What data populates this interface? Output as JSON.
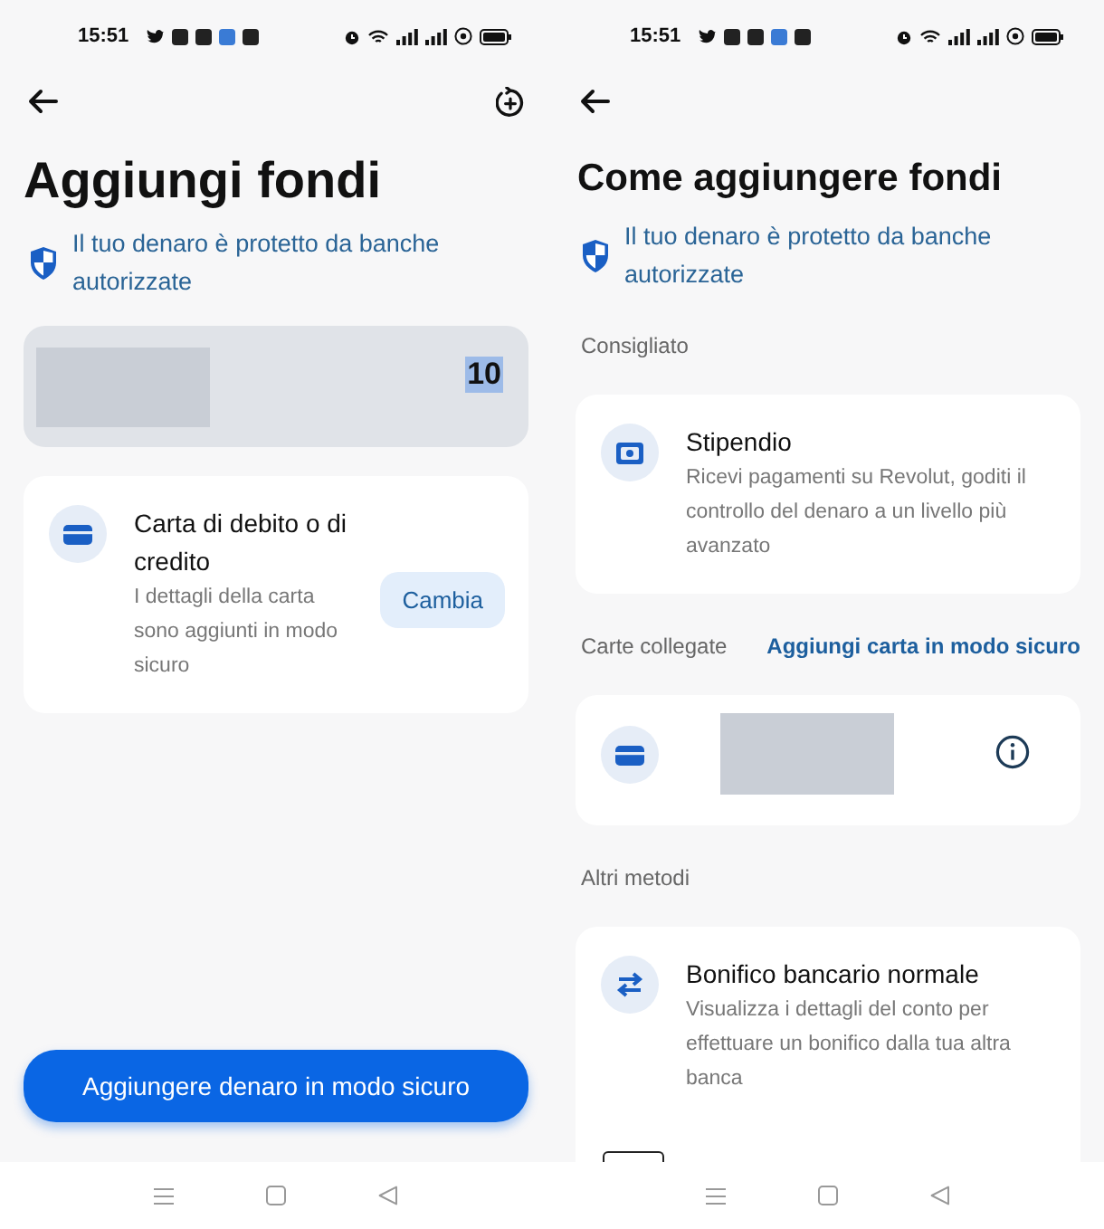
{
  "screens": [
    {
      "kind": "add_funds",
      "status_time": "15:51",
      "title": "Aggiungi fondi",
      "protection_note": "Il tuo denaro è protetto da banche autorizzate",
      "amount": {
        "value": "10",
        "selected": true
      },
      "payment_method": {
        "title": "Carta di debito o di credito",
        "subtitle": "I dettagli della carta sono aggiunti in modo sicuro",
        "action": "Cambia"
      },
      "primary_button": "Aggiungere denaro in modo sicuro"
    },
    {
      "kind": "methods",
      "status_time": "15:51",
      "title": "Come aggiungere fondi",
      "protection_note": "Il tuo denaro è protetto da banche autorizzate",
      "sections": [
        {
          "heading": "Consigliato",
          "items": [
            {
              "kind": "salary",
              "title": "Stipendio",
              "description": "Ricevi pagamenti su Revolut, goditi il controllo del denaro a un livello più avanzato"
            }
          ]
        },
        {
          "heading": "Carte collegate",
          "link": "Aggiungi carta in modo sicuro",
          "items": [
            {
              "kind": "card"
            }
          ]
        },
        {
          "heading": "Altri metodi",
          "items": [
            {
              "kind": "transfer",
              "title": "Bonifico bancario normale",
              "description": "Visualizza i dettagli del conto per effettuare un bonifico dalla tua altra banca"
            },
            {
              "kind": "cut_off"
            }
          ]
        }
      ]
    }
  ]
}
